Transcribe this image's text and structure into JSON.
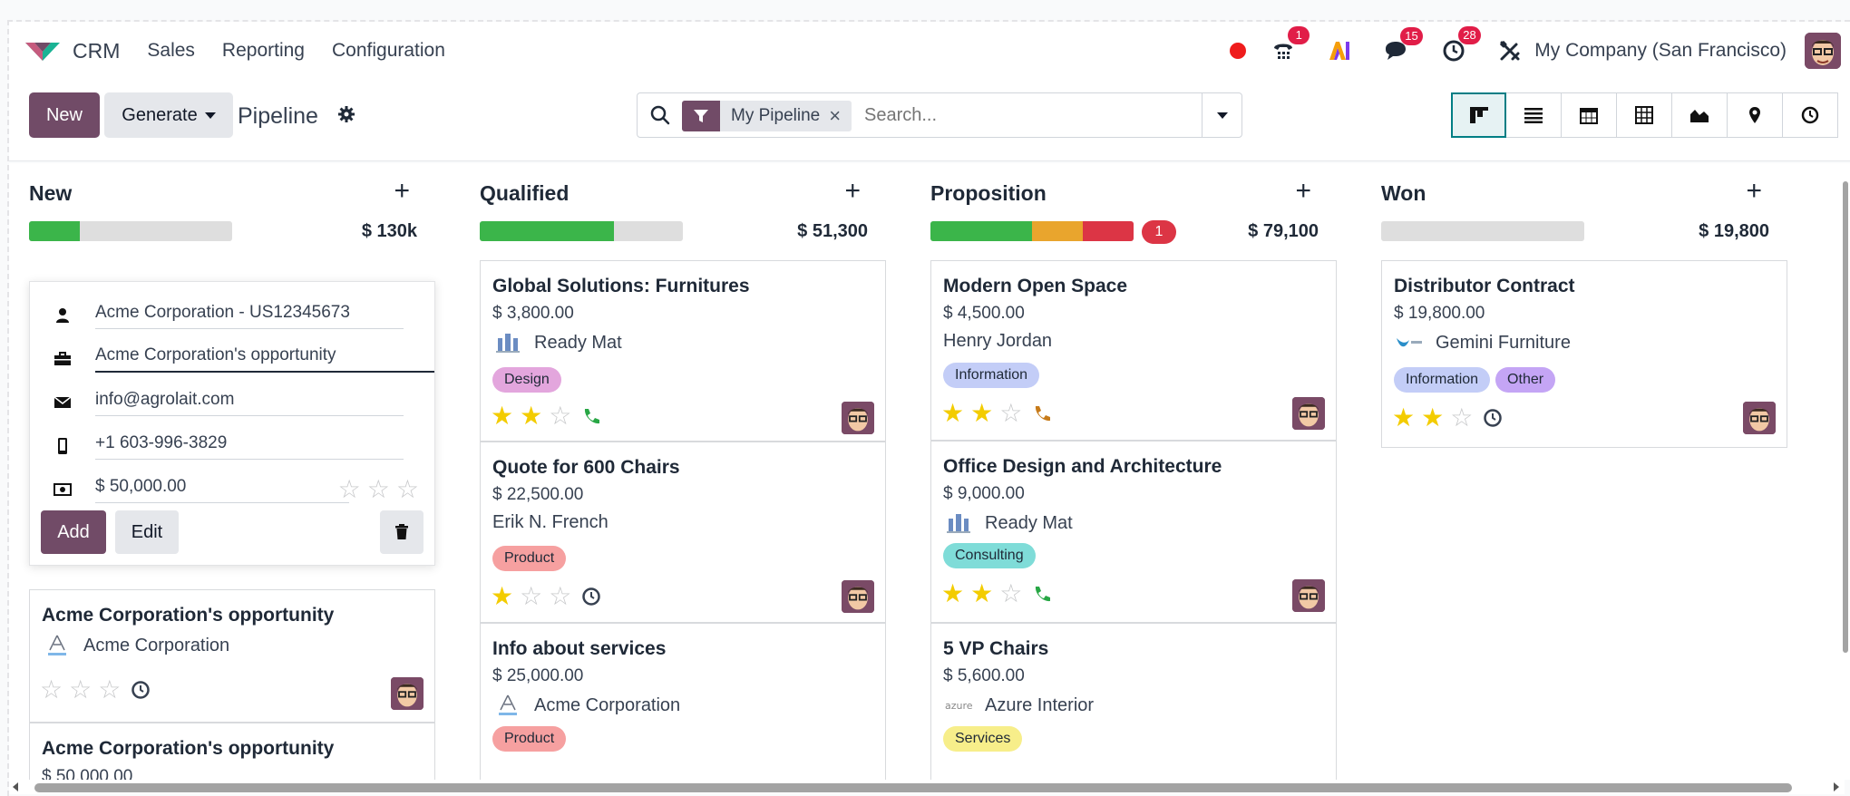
{
  "navbar": {
    "app_name": "CRM",
    "menus": [
      "Sales",
      "Reporting",
      "Configuration"
    ],
    "badges": {
      "phone": "1",
      "chat": "15",
      "activity": "28"
    },
    "company": "My Company (San Francisco)"
  },
  "control": {
    "new_label": "New",
    "generate_label": "Generate",
    "title": "Pipeline",
    "facet_label": "My Pipeline",
    "facet_remove": "×",
    "search_placeholder": "Search..."
  },
  "views": [
    "kanban-view-icon",
    "list-view-icon",
    "calendar-view-icon",
    "pivot-view-icon",
    "graph-view-icon",
    "map-view-icon",
    "activity-view-icon"
  ],
  "columns": [
    {
      "title": "New",
      "add": "+",
      "total": "$ 130k",
      "progress": {
        "green": 0.25,
        "orange": 0,
        "red": 0
      }
    },
    {
      "title": "Qualified",
      "add": "+",
      "total": "$ 51,300",
      "progress": {
        "green": 0.66,
        "orange": 0,
        "red": 0
      }
    },
    {
      "title": "Proposition",
      "add": "+",
      "total": "$ 79,100",
      "badge": "1",
      "progress": {
        "green": 0.5,
        "orange": 0.25,
        "red": 0.25
      }
    },
    {
      "title": "Won",
      "add": "+",
      "total": "$ 19,800",
      "progress": {
        "green": 0,
        "orange": 0,
        "red": 0
      }
    }
  ],
  "quick_create": {
    "contact": "Acme Corporation - US12345673",
    "opportunity": "Acme Corporation's opportunity",
    "email": "info@agrolait.com",
    "phone": "+1 603-996-3829",
    "revenue": "$ 50,000.00",
    "add_label": "Add",
    "edit_label": "Edit"
  },
  "cards": {
    "new": [
      {
        "title": "Acme Corporation's opportunity",
        "partner": "Acme Corporation",
        "stars": 0,
        "activity": "clock"
      },
      {
        "title": "Acme Corporation's opportunity",
        "revenue": "$ 50,000.00"
      }
    ],
    "qualified": [
      {
        "title": "Global Solutions: Furnitures",
        "revenue": "$ 3,800.00",
        "partner": "Ready Mat",
        "tags": [
          "Design"
        ],
        "stars": 2,
        "activity": "phone-green"
      },
      {
        "title": "Quote for 600 Chairs",
        "revenue": "$ 22,500.00",
        "partner": "Erik N. French",
        "tags": [
          "Product"
        ],
        "stars": 1,
        "activity": "clock"
      },
      {
        "title": "Info about services",
        "revenue": "$ 25,000.00",
        "partner": "Acme Corporation",
        "tags": [
          "Product"
        ]
      }
    ],
    "proposition": [
      {
        "title": "Modern Open Space",
        "revenue": "$ 4,500.00",
        "partner": "Henry Jordan",
        "tags": [
          "Information"
        ],
        "stars": 2,
        "activity": "phone-orange"
      },
      {
        "title": "Office Design and Architecture",
        "revenue": "$ 9,000.00",
        "partner": "Ready Mat",
        "tags": [
          "Consulting"
        ],
        "stars": 2,
        "activity": "phone-green"
      },
      {
        "title": "5 VP Chairs",
        "revenue": "$ 5,600.00",
        "partner": "Azure Interior",
        "tags": [
          "Services"
        ]
      }
    ],
    "won": [
      {
        "title": "Distributor Contract",
        "revenue": "$ 19,800.00",
        "partner": "Gemini Furniture",
        "tags": [
          "Information",
          "Other"
        ],
        "stars": 2,
        "activity": "clock"
      }
    ]
  },
  "colors": {
    "brand": "#714b67",
    "tag_design": "#e3a6dd",
    "tag_product": "#f6a0a0",
    "tag_information": "#c3cdf7",
    "tag_consulting": "#7fdcd8",
    "tag_services": "#f7ee8a",
    "tag_other": "#c4a5f5"
  }
}
